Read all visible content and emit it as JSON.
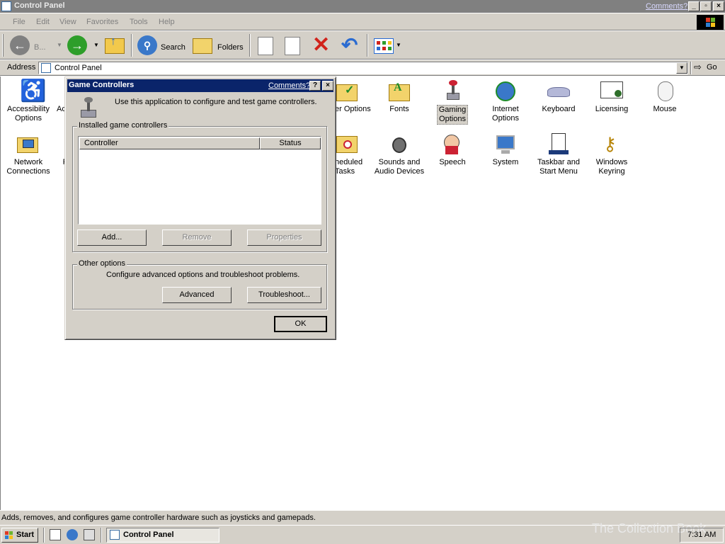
{
  "window": {
    "title": "Control Panel",
    "comments_link": "Comments?"
  },
  "menu": [
    "File",
    "Edit",
    "View",
    "Favorites",
    "Tools",
    "Help"
  ],
  "toolbar": {
    "back_label": "B...",
    "search_label": "Search",
    "folders_label": "Folders"
  },
  "address": {
    "label": "Address",
    "value": "Control Panel",
    "go_label": "Go"
  },
  "control_panel_items": [
    {
      "label": "Accessibility Options",
      "icon": "accessibility-icon",
      "l1": "Accessibility",
      "l2": "Options"
    },
    {
      "label": "Ac",
      "icon": "add-hardware-icon",
      "l1": "Ac",
      "l2": ""
    },
    {
      "label": "er Options",
      "icon": "folder-options-icon",
      "l1": "er Options",
      "l2": ""
    },
    {
      "label": "Fonts",
      "icon": "fonts-icon",
      "l1": "Fonts",
      "l2": ""
    },
    {
      "label": "Gaming Options",
      "icon": "joystick-icon",
      "l1": "Gaming",
      "l2": "Options"
    },
    {
      "label": "Internet Options",
      "icon": "globe-icon",
      "l1": "Internet",
      "l2": "Options"
    },
    {
      "label": "Keyboard",
      "icon": "keyboard-icon",
      "l1": "Keyboard",
      "l2": ""
    },
    {
      "label": "Licensing",
      "icon": "certificate-icon",
      "l1": "Licensing",
      "l2": ""
    },
    {
      "label": "Mouse",
      "icon": "mouse-icon",
      "l1": "Mouse",
      "l2": ""
    },
    {
      "label": "Network Connections",
      "icon": "network-icon",
      "l1": "Network",
      "l2": "Connections"
    },
    {
      "label": "F",
      "icon": "partial-icon",
      "l1": "F",
      "l2": "I"
    },
    {
      "label": "heduled Tasks",
      "icon": "scheduled-tasks-icon",
      "l1": "heduled",
      "l2": "Tasks"
    },
    {
      "label": "Sounds and Audio Devices",
      "icon": "speaker-icon",
      "l1": "Sounds and",
      "l2": "Audio Devices"
    },
    {
      "label": "Speech",
      "icon": "speech-icon",
      "l1": "Speech",
      "l2": ""
    },
    {
      "label": "System",
      "icon": "system-icon",
      "l1": "System",
      "l2": ""
    },
    {
      "label": "Taskbar and Start Menu",
      "icon": "taskbar-icon",
      "l1": "Taskbar and",
      "l2": "Start Menu"
    },
    {
      "label": "Windows Keyring",
      "icon": "keyring-icon",
      "l1": "Windows",
      "l2": "Keyring"
    }
  ],
  "dialog": {
    "title": "Game Controllers",
    "comments_link": "Comments?",
    "help_btn": "?",
    "close_btn": "×",
    "description": "Use this application to configure and test game controllers.",
    "installed_group": "Installed game controllers",
    "columns": [
      "Controller",
      "Status"
    ],
    "rows": [],
    "add_btn": "Add...",
    "remove_btn": "Remove",
    "properties_btn": "Properties",
    "other_group": "Other options",
    "other_text": "Configure advanced options and troubleshoot problems.",
    "advanced_btn": "Advanced",
    "troubleshoot_btn": "Troubleshoot...",
    "ok_btn": "OK"
  },
  "status_text": "Adds, removes, and configures game controller hardware such as joysticks and gamepads.",
  "taskbar": {
    "start_label": "Start",
    "task_label": "Control Panel",
    "clock": "7:31 AM"
  },
  "watermark": "The Collection Book",
  "colors": {
    "titlebar_inactive": "#808080",
    "dialog_titlebar": "#0a246a",
    "face": "#d4d0c8"
  }
}
